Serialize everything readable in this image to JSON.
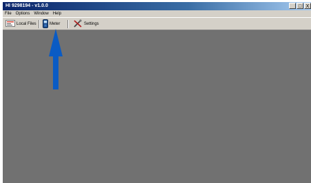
{
  "window": {
    "title": "HI 9298194 - v1.0.0",
    "controls": {
      "minimize": "_",
      "maximize": "□",
      "close": "X"
    }
  },
  "menu": {
    "items": [
      "File",
      "Options",
      "Window",
      "Help"
    ]
  },
  "toolbar": {
    "buttons": [
      {
        "label": "Local Files",
        "icon": "local-files-icon"
      },
      {
        "label": "Meter",
        "icon": "meter-device-icon"
      },
      {
        "label": "Settings",
        "icon": "settings-tools-icon"
      }
    ]
  },
  "annotation": {
    "arrow_color": "#0a5bc4",
    "points_to": "Meter"
  },
  "colors": {
    "client_area": "#717171",
    "titlebar": "#0a246a"
  }
}
